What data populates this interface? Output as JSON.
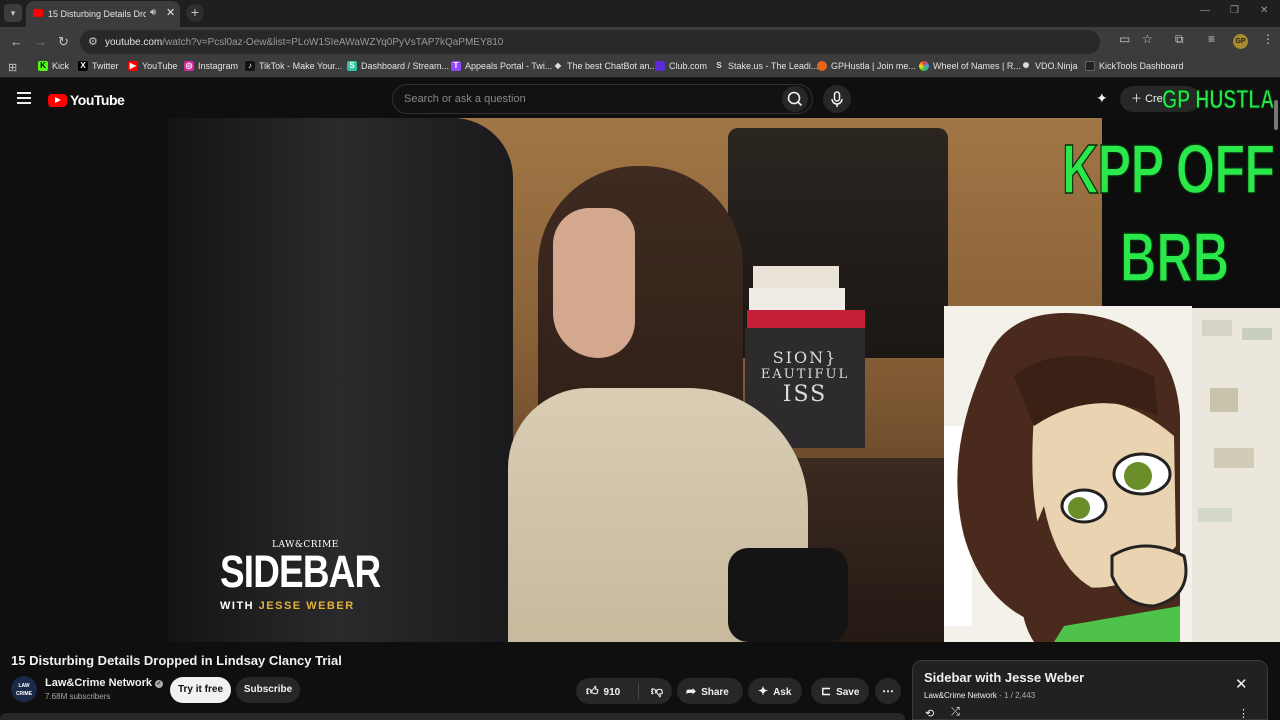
{
  "browser": {
    "tab_title": "15 Disturbing Details Dropp",
    "url_host": "youtube.com",
    "url_rest": "/watch?v=Pcsl0az-Oew&list=PLoW1SIeAWaWZYq0PyVsTAP7kQaPMEY810",
    "profile_initials": "GP",
    "icons": [
      "tab-search-icon",
      "speaker-icon",
      "close-icon",
      "plus-icon",
      "back-icon",
      "forward-icon",
      "reload-icon",
      "site-info-icon",
      "cast-icon",
      "star-icon",
      "extensions-icon",
      "media-icon",
      "kebab-icon",
      "apps-icon"
    ]
  },
  "bookmarks": [
    {
      "label": "Kick",
      "icon": "kick-icon",
      "color": "#53fc18"
    },
    {
      "label": "Twitter",
      "icon": "x-icon",
      "color": "#000000"
    },
    {
      "label": "YouTube",
      "icon": "youtube-icon",
      "color": "#ff0000"
    },
    {
      "label": "Instagram",
      "icon": "instagram-icon",
      "color": "#d6249f"
    },
    {
      "label": "TikTok - Make Your...",
      "icon": "tiktok-icon",
      "color": "#111111"
    },
    {
      "label": "Dashboard / Stream...",
      "icon": "streamlabs-icon",
      "color": "#31c3a2"
    },
    {
      "label": "Appeals Portal - Twi...",
      "icon": "twitch-icon",
      "color": "#9146ff"
    },
    {
      "label": "The best ChatBot an...",
      "icon": "chatbot-icon",
      "color": "#dddddd"
    },
    {
      "label": "Club.com",
      "icon": "club-icon",
      "color": "#5b2bd6"
    },
    {
      "label": "Stake.us - The Leadi...",
      "icon": "stake-icon",
      "color": "#dddddd"
    },
    {
      "label": "GPHustla | Join me...",
      "icon": "gphustla-icon",
      "color": "#e8641b"
    },
    {
      "label": "Wheel of Names | R...",
      "icon": "wheel-icon",
      "color": "#3aa0ff"
    },
    {
      "label": "VDO.Ninja",
      "icon": "vdo-ninja-icon",
      "color": "#dddddd"
    },
    {
      "label": "KickTools Dashboard",
      "icon": "kicktools-icon",
      "color": "#222222"
    }
  ],
  "youtube": {
    "logo_text": "YouTube",
    "search_placeholder": "Search or ask a question",
    "create_label": "Cre"
  },
  "video": {
    "show_brand": "LAW&CRIME",
    "show_name": "SIDEBAR",
    "show_sub_prefix": "WITH",
    "show_sub_host": "JESSE WEBER",
    "box_text_1": "SION}",
    "box_text_2": "EAUTIFUL",
    "box_text_3": "ISS"
  },
  "overlay": {
    "channel_tag": "GP HUSTLA",
    "status_line1": "KPP OFF",
    "status_line2": "BRB",
    "accent_color": "#2ae84a"
  },
  "details": {
    "title": "15 Disturbing Details Dropped in Lindsay Clancy Trial",
    "channel_name": "Law&Crime Network",
    "avatar_text": "LAW CRIME",
    "subscribers": "7.68M subscribers",
    "try_label": "Try it free",
    "subscribe_label": "Subscribe",
    "likes": "910",
    "share_label": "Share",
    "ask_label": "Ask",
    "save_label": "Save"
  },
  "playlist": {
    "title": "Sidebar with Jesse Weber",
    "owner": "Law&Crime Network",
    "separator": " - ",
    "position": "1 / 2,443"
  }
}
